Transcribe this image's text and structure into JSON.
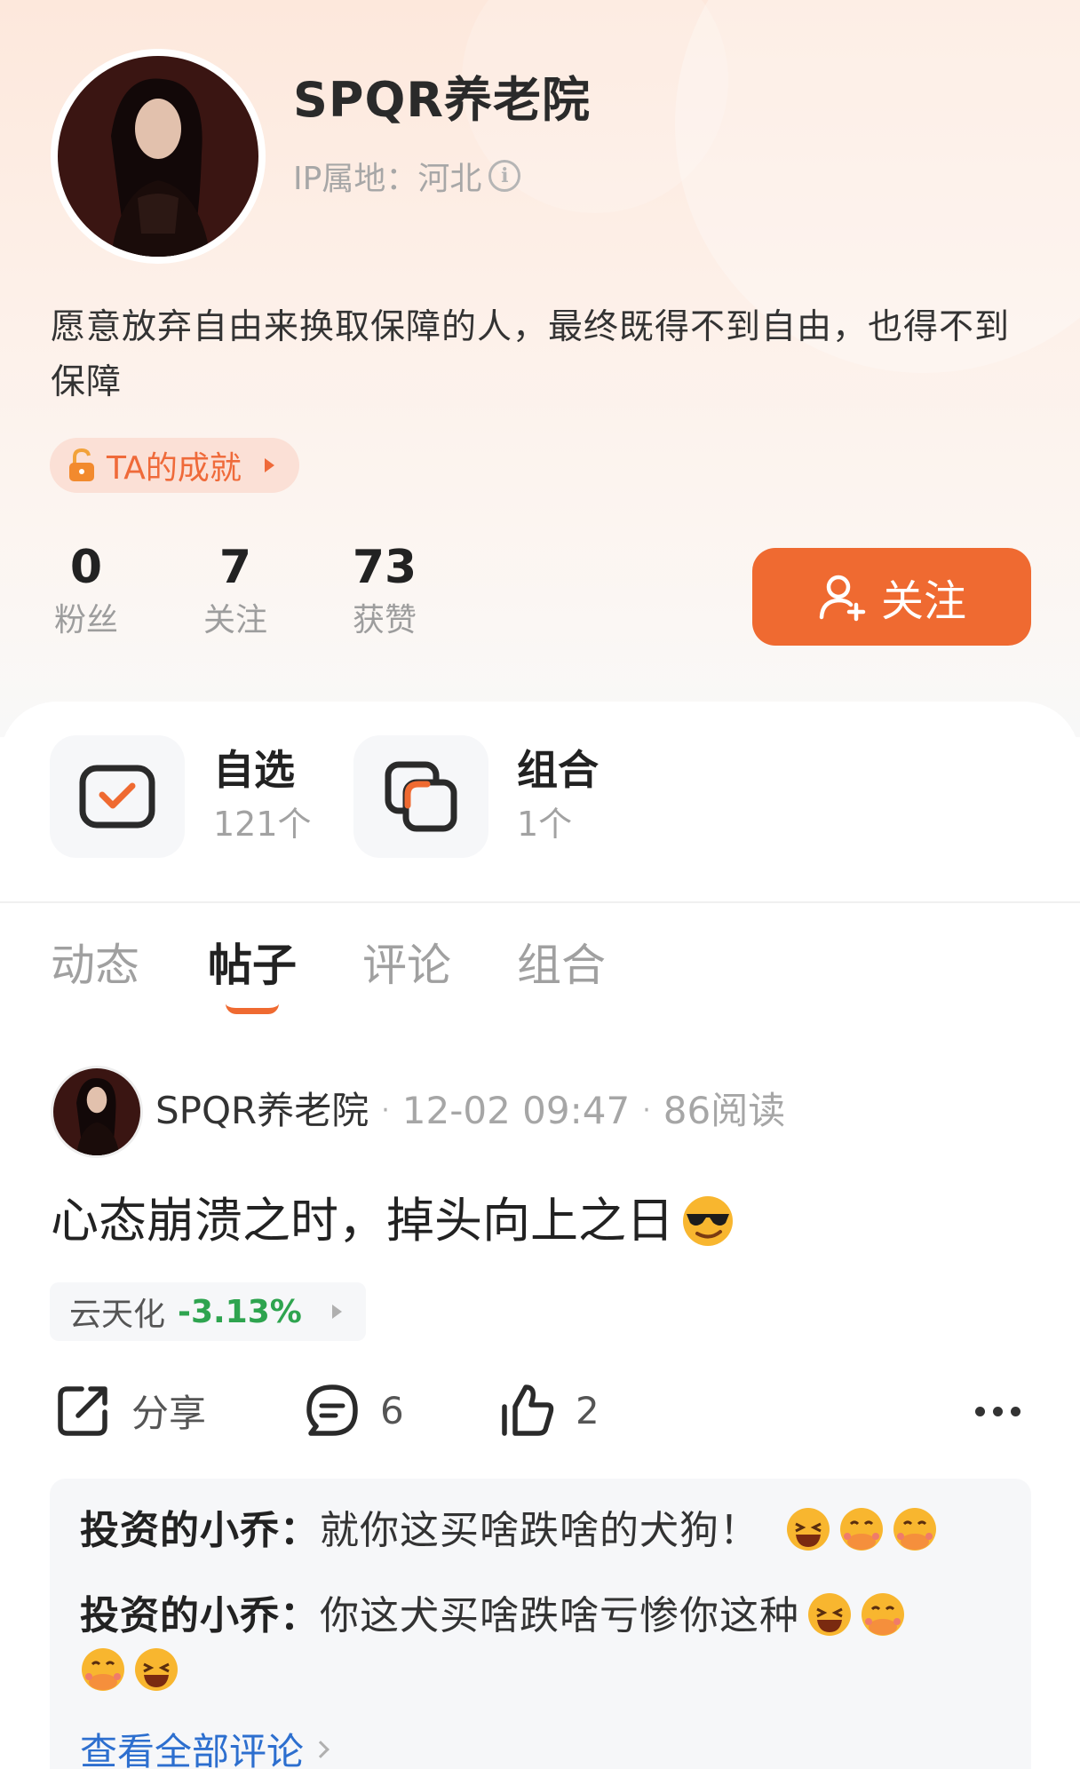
{
  "profile": {
    "name": "SPQR养老院",
    "ip_location": "IP属地：河北",
    "bio": "愿意放弃自由来换取保障的人，最终既得不到自由，也得不到保障",
    "achievement_label": "TA的成就",
    "stats": [
      {
        "value": "0",
        "label": "粉丝"
      },
      {
        "value": "7",
        "label": "关注"
      },
      {
        "value": "73",
        "label": "获赞"
      }
    ],
    "follow_button": "关注"
  },
  "features": [
    {
      "title": "自选",
      "count": "121个",
      "icon": "checkbox-icon"
    },
    {
      "title": "组合",
      "count": "1个",
      "icon": "combo-icon"
    }
  ],
  "tabs": [
    {
      "label": "动态",
      "active": false
    },
    {
      "label": "帖子",
      "active": true
    },
    {
      "label": "评论",
      "active": false
    },
    {
      "label": "组合",
      "active": false
    }
  ],
  "post": {
    "author": "SPQR养老院",
    "time": "12-02 09:47",
    "reads": "86阅读",
    "title": "心态崩溃之时，掉头向上之日",
    "title_emoji": "sunglasses-emoji",
    "stock": {
      "name": "云天化",
      "change": "-3.13%",
      "change_color": "#2ea44f"
    },
    "actions": {
      "share": "分享",
      "comments": "6",
      "likes": "2"
    },
    "comments": [
      {
        "user": "投资的小乔：",
        "text": "就你这买啥跌啥的犬狗！",
        "emojis": [
          "laughing-emoji",
          "covering-mouth-emoji",
          "covering-mouth-emoji"
        ]
      },
      {
        "user": "投资的小乔：",
        "text": "你这犬买啥跌啥亏惨你这种",
        "emojis": [
          "laughing-emoji",
          "covering-mouth-emoji",
          "covering-mouth-emoji",
          "laughing-emoji"
        ]
      }
    ],
    "see_all": "查看全部评论"
  },
  "colors": {
    "accent": "#ef6a31",
    "link": "#2d6fcf",
    "down": "#2ea44f"
  }
}
